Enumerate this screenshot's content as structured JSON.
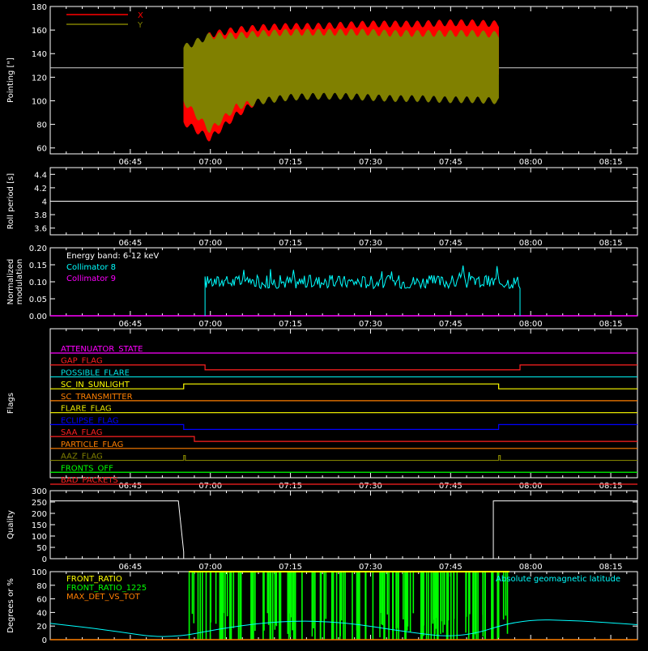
{
  "chart_data": [
    {
      "id": "pointing",
      "type": "line",
      "ylabel": "Pointing [\"]",
      "ylim": [
        55,
        180
      ],
      "yticks": [
        60,
        80,
        100,
        120,
        140,
        160,
        180
      ],
      "xticks": [
        "06:45",
        "07:00",
        "07:15",
        "07:30",
        "07:45",
        "08:00",
        "08:15"
      ],
      "legend_position": "top-left",
      "reference_line": 128,
      "series": [
        {
          "name": "X",
          "color": "#ff0000",
          "x_start": "06:55",
          "x_end": "07:54",
          "upper": [
            130,
            156,
            160,
            162,
            163,
            163,
            164,
            165,
            165,
            165,
            166,
            166,
            165
          ],
          "lower": [
            82,
            68,
            88,
            103,
            110,
            114,
            117,
            119,
            119,
            120,
            120,
            120,
            120
          ]
        },
        {
          "name": "Y",
          "color": "#808000",
          "x_start": "06:55",
          "x_end": "07:54",
          "upper": [
            145,
            155,
            155,
            157,
            158,
            158,
            158,
            158,
            157,
            157,
            157,
            157,
            156
          ],
          "lower": [
            100,
            75,
            95,
            100,
            103,
            104,
            104,
            103,
            102,
            102,
            101,
            101,
            100
          ]
        }
      ]
    },
    {
      "id": "roll",
      "type": "line",
      "ylabel": "Roll period [s]",
      "ylim": [
        3.5,
        4.5
      ],
      "yticks": [
        3.6,
        3.8,
        4.0,
        4.2,
        4.4
      ],
      "xticks": [
        "06:45",
        "07:00",
        "07:15",
        "07:30",
        "07:45",
        "08:00",
        "08:15"
      ],
      "series": [
        {
          "name": "",
          "color": "#ffffff",
          "x": [
            "06:30",
            "08:20"
          ],
          "y": [
            4.0,
            4.0
          ]
        }
      ]
    },
    {
      "id": "modulation",
      "type": "line",
      "ylabel": "Normalized modulation",
      "ylim": [
        0,
        0.2
      ],
      "yticks": [
        "0.00",
        "0.05",
        "0.10",
        "0.15",
        "0.20"
      ],
      "xticks": [
        "06:45",
        "07:00",
        "07:15",
        "07:30",
        "07:45",
        "08:00",
        "08:15"
      ],
      "annotation": "Energy band: 6-12 keV",
      "series": [
        {
          "name": "Collimator 8",
          "color": "#00ffff",
          "x_start": "06:59",
          "x_end": "07:58",
          "mean": 0.1,
          "spread": 0.02
        },
        {
          "name": "Collimator 9",
          "color": "#ff00ff",
          "x": [
            "06:30",
            "08:20"
          ],
          "y": [
            0,
            0
          ]
        }
      ]
    },
    {
      "id": "flags",
      "type": "line",
      "ylabel": "Flags",
      "xticks": [
        "06:45",
        "07:00",
        "07:15",
        "07:30",
        "07:45",
        "08:00",
        "08:15"
      ],
      "series": [
        {
          "name": "ATTENUATOR_STATE",
          "color": "#ff00ff",
          "steps": []
        },
        {
          "name": "GAP_FLAG",
          "color": "#ff2020",
          "steps": [
            [
              "06:59",
              "07:58",
              -1
            ]
          ]
        },
        {
          "name": "POSSIBLE_FLARE",
          "color": "#00e5e5",
          "steps": []
        },
        {
          "name": "SC_IN_SUNLIGHT",
          "color": "#ffff00",
          "steps": [
            [
              "06:55",
              "07:54",
              1
            ]
          ]
        },
        {
          "name": "SC_TRANSMITTER",
          "color": "#ff7f00",
          "steps": []
        },
        {
          "name": "FLARE_FLAG",
          "color": "#e6e600",
          "steps": []
        },
        {
          "name": "ECLIPSE_FLAG",
          "color": "#0000ff",
          "steps": [
            [
              "06:55",
              "07:54",
              -1
            ]
          ]
        },
        {
          "name": "SAA_FLAG",
          "color": "#ff2020",
          "steps": [
            [
              "06:57",
              "08:20",
              -1
            ]
          ]
        },
        {
          "name": "PARTICLE_FLAG",
          "color": "#ff7f00",
          "steps": []
        },
        {
          "name": "AAZ_FLAG",
          "color": "#808000",
          "pulses": [
            "06:55",
            "07:54"
          ]
        },
        {
          "name": "FRONTS_OFF",
          "color": "#00ff00",
          "steps": []
        },
        {
          "name": "BAD_PACKETS",
          "color": "#ff2020",
          "steps": []
        }
      ]
    },
    {
      "id": "quality",
      "type": "line",
      "ylabel": "Quality",
      "ylim": [
        0,
        300
      ],
      "yticks": [
        0,
        50,
        100,
        150,
        200,
        250,
        300
      ],
      "xticks": [
        "06:45",
        "07:00",
        "07:15",
        "07:30",
        "07:45",
        "08:00",
        "08:15"
      ],
      "series": [
        {
          "name": "",
          "color": "#ffffff",
          "x": [
            "06:30",
            "06:54",
            "06:55",
            "06:55",
            "07:53",
            "07:53",
            "08:20"
          ],
          "y": [
            255,
            255,
            30,
            0,
            0,
            255,
            255
          ]
        }
      ]
    },
    {
      "id": "front_ratio",
      "type": "line",
      "ylabel": "Degrees or %",
      "ylim": [
        0,
        100
      ],
      "yticks": [
        0,
        20,
        40,
        60,
        80,
        100
      ],
      "series": [
        {
          "name": "FRONT_RATIO",
          "color": "#ffff00",
          "x_start": "06:56",
          "x_end": "07:56",
          "value": 100
        },
        {
          "name": "FRONT_RATIO_1225",
          "color": "#00ff00",
          "x_start": "06:56",
          "x_end": "07:56",
          "value": 100
        },
        {
          "name": "MAX_DET_VS_TOT",
          "color": "#ff7f00",
          "x": [
            "06:30",
            "08:20"
          ],
          "y": [
            0,
            0
          ]
        },
        {
          "name": "Absolute geomagnetic latitude",
          "color": "#00ffff",
          "x": [
            "06:30",
            "06:41",
            "06:52",
            "07:03",
            "07:14",
            "07:25",
            "07:36",
            "07:47",
            "07:58",
            "08:09",
            "08:20"
          ],
          "y": [
            24,
            14,
            1,
            18,
            28,
            26,
            12,
            2,
            30,
            28,
            22
          ]
        }
      ]
    }
  ]
}
